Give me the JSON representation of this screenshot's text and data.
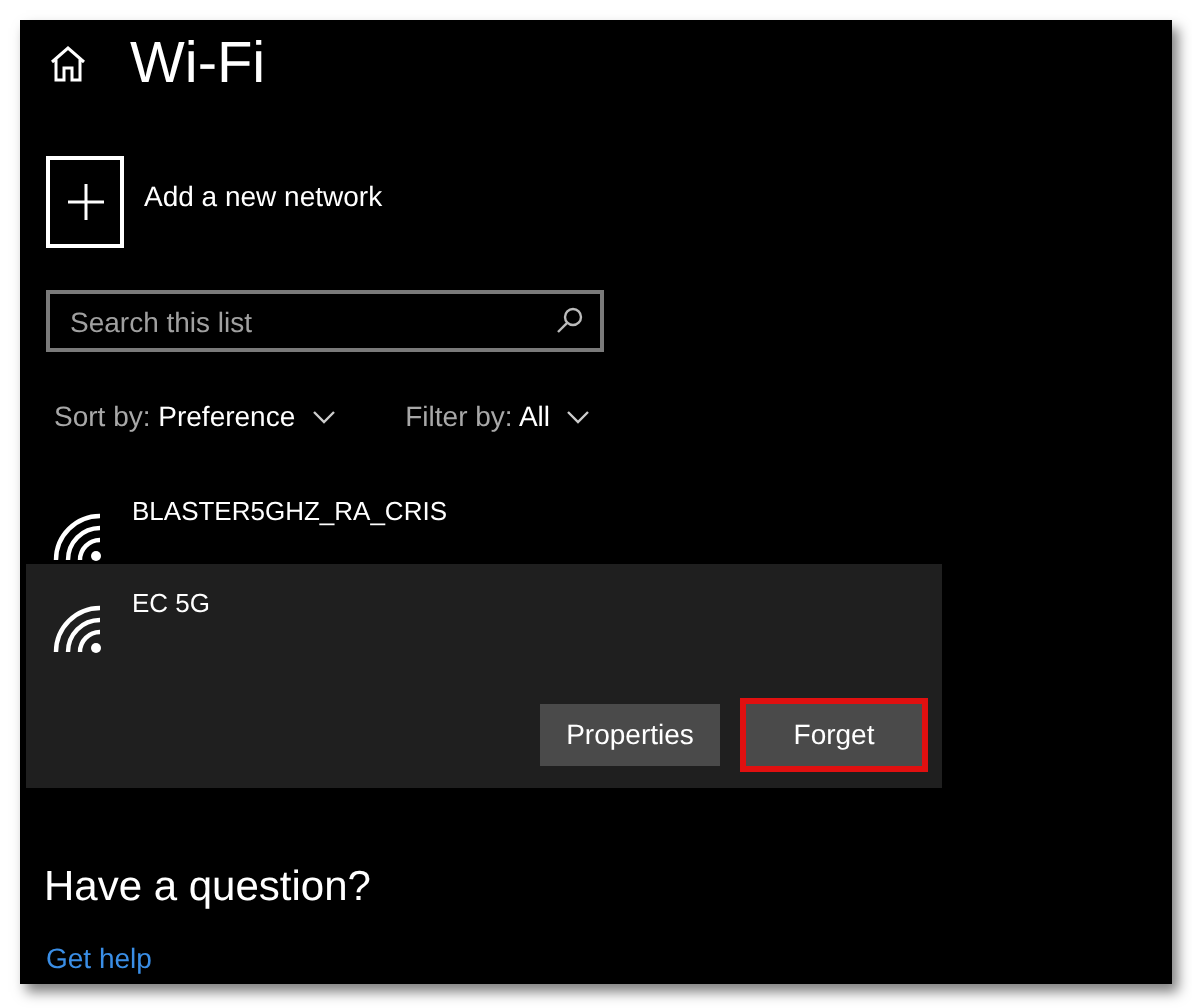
{
  "window": {
    "title": "Wi-Fi"
  },
  "add_network": {
    "label": "Add a new network"
  },
  "search": {
    "placeholder": "Search this list"
  },
  "sort": {
    "label": "Sort by:",
    "value": "Preference"
  },
  "filter": {
    "label": "Filter by:",
    "value": "All"
  },
  "networks": [
    {
      "name": "BLASTER5GHZ_RA_CRIS",
      "selected": false
    },
    {
      "name": "EC 5G",
      "selected": true
    }
  ],
  "network_actions": [
    {
      "label": "Properties",
      "highlighted": false
    },
    {
      "label": "Forget",
      "highlighted": true
    }
  ],
  "help": {
    "heading": "Have a question?",
    "link": "Get help"
  }
}
